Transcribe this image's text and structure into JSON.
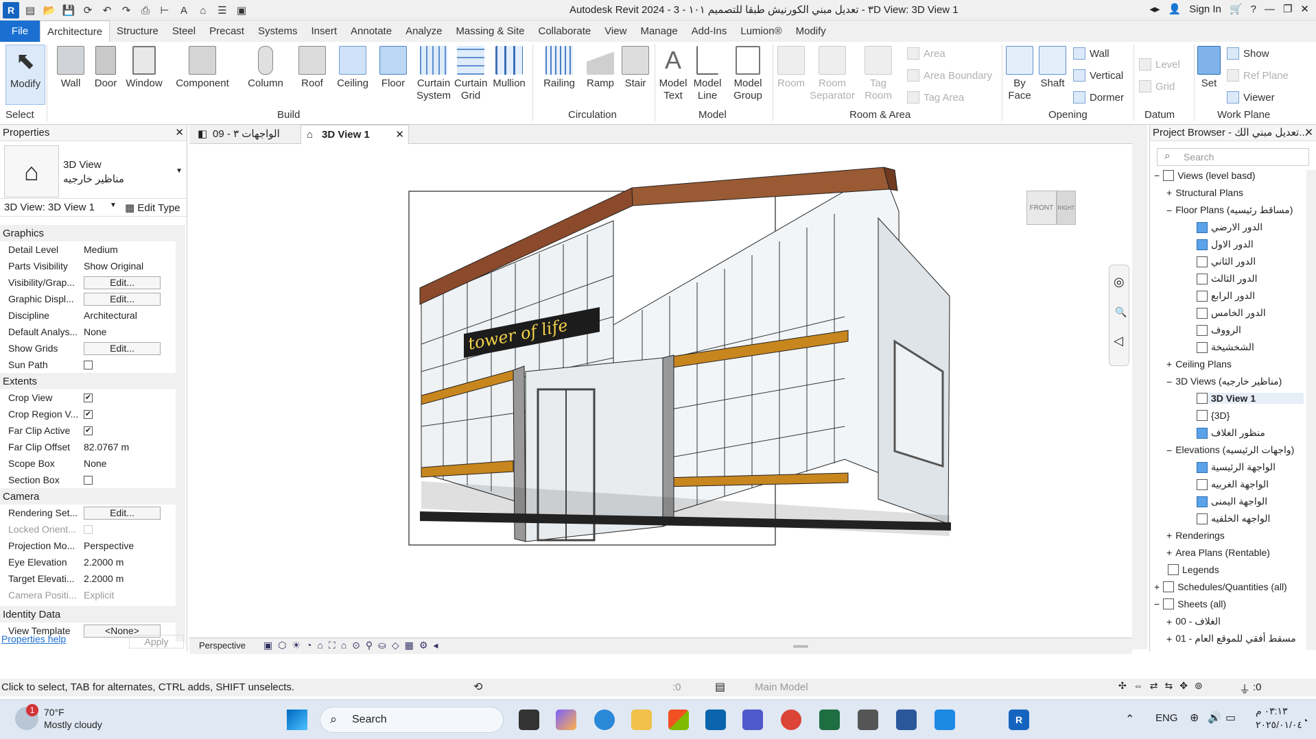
{
  "app": {
    "title": "Autodesk Revit 2024 - ٣ - تعديل مبني الكورنيش طبقا للتصميم ١٠١ - 3D View: 3D View 1",
    "sign_in": "Sign In"
  },
  "tabs": [
    "File",
    "Architecture",
    "Structure",
    "Steel",
    "Precast",
    "Systems",
    "Insert",
    "Annotate",
    "Analyze",
    "Massing & Site",
    "Collaborate",
    "View",
    "Manage",
    "Add-Ins",
    "Lumion®",
    "Modify"
  ],
  "ribbon": {
    "select": {
      "modify": "Modify",
      "panel": "Select"
    },
    "build": {
      "panel": "Build",
      "wall": "Wall",
      "door": "Door",
      "window": "Window",
      "component": "Component",
      "column": "Column",
      "roof": "Roof",
      "ceiling": "Ceiling",
      "floor": "Floor",
      "curtain_system": "Curtain System",
      "curtain_grid": "Curtain Grid",
      "mullion": "Mullion"
    },
    "circulation": {
      "panel": "Circulation",
      "railing": "Railing",
      "ramp": "Ramp",
      "stair": "Stair"
    },
    "model": {
      "panel": "Model",
      "model_text": "Model Text",
      "model_line": "Model Line",
      "model_group": "Model Group"
    },
    "room_area": {
      "panel": "Room & Area",
      "room": "Room",
      "room_separator": "Room Separator",
      "tag_room": "Tag Room",
      "area": "Area",
      "area_boundary": "Area Boundary",
      "tag_area": "Tag Area"
    },
    "opening": {
      "panel": "Opening",
      "by_face": "By Face",
      "shaft": "Shaft",
      "wall": "Wall",
      "vertical": "Vertical",
      "dormer": "Dormer"
    },
    "datum": {
      "panel": "Datum",
      "level": "Level",
      "grid": "Grid"
    },
    "work_plane": {
      "panel": "Work Plane",
      "set": "Set",
      "show": "Show",
      "ref_plane": "Ref Plane",
      "viewer": "Viewer"
    }
  },
  "properties": {
    "header": "Properties",
    "type_name": "3D View",
    "type_sub": "مناظير خارجيه",
    "selector": "3D View: 3D View 1",
    "edit_type": "Edit Type",
    "sections": {
      "graphics": "Graphics",
      "extents": "Extents",
      "camera": "Camera",
      "identity": "Identity Data"
    },
    "rows": {
      "detail_level": [
        "Detail Level",
        "Medium"
      ],
      "parts_visibility": [
        "Parts Visibility",
        "Show Original"
      ],
      "visibility_graphics": [
        "Visibility/Grap...",
        "Edit..."
      ],
      "graphic_display": [
        "Graphic Displ...",
        "Edit..."
      ],
      "discipline": [
        "Discipline",
        "Architectural"
      ],
      "default_analysis": [
        "Default Analys...",
        "None"
      ],
      "show_grids": [
        "Show Grids",
        "Edit..."
      ],
      "sun_path": [
        "Sun Path",
        ""
      ],
      "crop_view": [
        "Crop View",
        ""
      ],
      "crop_region": [
        "Crop Region V...",
        ""
      ],
      "far_clip_active": [
        "Far Clip Active",
        ""
      ],
      "far_clip_offset": [
        "Far Clip Offset",
        "82.0767 m"
      ],
      "scope_box": [
        "Scope Box",
        "None"
      ],
      "section_box": [
        "Section Box",
        ""
      ],
      "rendering_settings": [
        "Rendering Set...",
        "Edit..."
      ],
      "locked_orientation": [
        "Locked Orient...",
        ""
      ],
      "projection_mode": [
        "Projection Mo...",
        "Perspective"
      ],
      "eye_elevation": [
        "Eye Elevation",
        "2.2000 m"
      ],
      "target_elevation": [
        "Target Elevati...",
        "2.2000 m"
      ],
      "camera_position": [
        "Camera Positi...",
        "Explicit"
      ],
      "view_template": [
        "View Template",
        "<None>"
      ]
    },
    "help": "Properties help",
    "apply": "Apply"
  },
  "views": {
    "tab1": "الواجهات ٣ - 09",
    "tab2": "3D View 1",
    "sign": "tower of life",
    "viewcube_front": "FRONT",
    "viewcube_right": "RIGHT",
    "view_control": "Perspective"
  },
  "browser": {
    "header": "Project Browser - تعديل مبني الك...",
    "search": "Search",
    "items": [
      "Views (level basd)",
      "Structural Plans",
      "Floor Plans (مساقط رئيسيه)",
      "الدور الارضي",
      "الدور الاول",
      "الدور الثاني",
      "الدور الثالث",
      "الدور الرابع",
      "الدور الخامس",
      "الرووف",
      "الشخشيخة",
      "Ceiling Plans",
      "3D Views (مناظير خارجيه)",
      "3D View 1",
      "{3D}",
      "منظور الغلاف",
      "Elevations (واجهات الرئيسيه)",
      "الواجهة الرئيسية",
      "الواجهة الغربيه",
      "الواجهة اليمنى",
      "الواجهه الخلفيه",
      "Renderings",
      "Area Plans (Rentable)",
      "Legends",
      "Schedules/Quantities (all)",
      "Sheets (all)",
      "00 - الغلاف",
      "01 - مسقط أفقي للموقع العام"
    ]
  },
  "status": {
    "hint": "Click to select, TAB for alternates, CTRL adds, SHIFT unselects.",
    "zero": ":0",
    "model": "Main Model",
    "filter": ":0"
  },
  "taskbar": {
    "weather_temp": "70°F",
    "weather_desc": "Mostly cloudy",
    "notif": "1",
    "search": "Search",
    "lang": "ENG",
    "time": "٠٣:١٣ م",
    "date": "٢٠٢٥/٠١/٠٤"
  },
  "colors": {
    "accent": "#1a6fd1",
    "wood": "#8b4a2b",
    "gold": "#c8861e",
    "glass": "#e9eef2"
  }
}
